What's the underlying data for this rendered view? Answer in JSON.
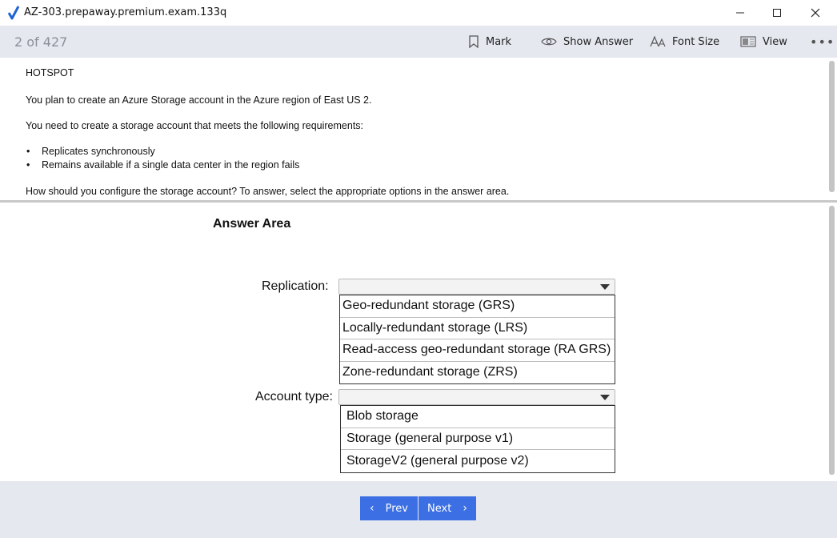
{
  "window": {
    "title": "AZ-303.prepaway.premium.exam.133q",
    "minimize_icon": "minimize-icon",
    "maximize_icon": "maximize-icon",
    "close_icon": "close-icon"
  },
  "toolbar": {
    "counter": "2 of 427",
    "mark_label": "Mark",
    "show_answer_label": "Show Answer",
    "font_size_label": "Font Size",
    "view_label": "View",
    "more_label": "•••"
  },
  "question": {
    "type": "HOTSPOT",
    "line1": "You plan to create an Azure Storage account in the Azure region of East US 2.",
    "line2": "You need to create a storage account that meets the following requirements:",
    "requirements": [
      "Replicates synchronously",
      "Remains available if a single data center in the region fails"
    ],
    "line3": "How should you configure the storage account? To answer, select the appropriate options in the answer area."
  },
  "answer_area": {
    "title": "Answer Area",
    "replication": {
      "label": "Replication:",
      "selected": "",
      "options": [
        "Geo-redundant storage (GRS)",
        "Locally-redundant storage (LRS)",
        "Read-access geo-redundant storage (RA GRS)",
        "Zone-redundant storage (ZRS)"
      ]
    },
    "account_type": {
      "label": "Account type:",
      "selected": "",
      "options": [
        "Blob storage",
        "Storage (general purpose v1)",
        "StorageV2 (general purpose v2)"
      ]
    }
  },
  "nav": {
    "prev_label": "Prev",
    "next_label": "Next"
  },
  "colors": {
    "accent": "#3b6fe3",
    "toolbar_bg": "#e6e8f0",
    "check": "#1e64d2"
  }
}
